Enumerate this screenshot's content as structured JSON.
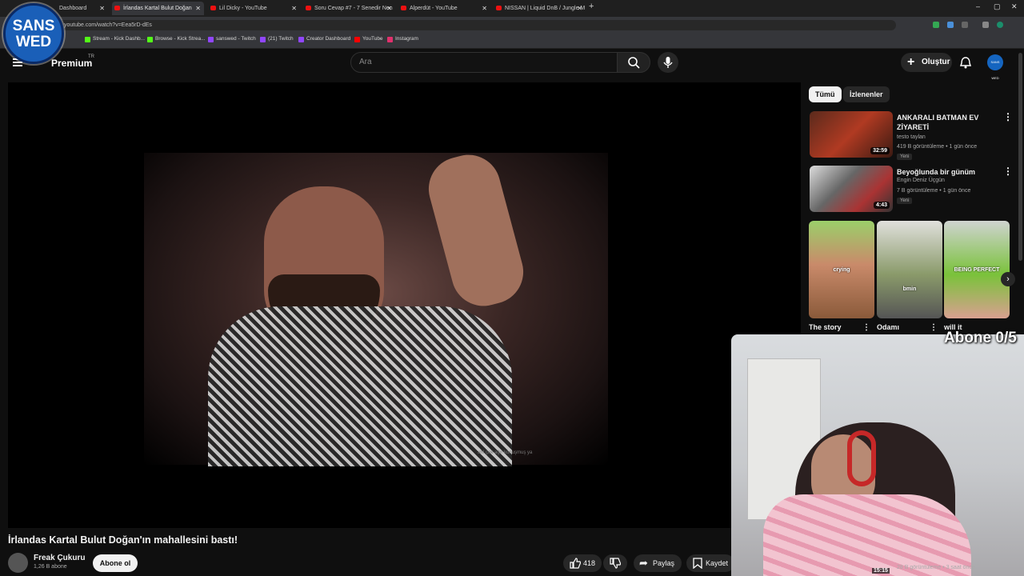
{
  "browser": {
    "tabs": [
      {
        "label": "Dashboard",
        "active": false
      },
      {
        "label": "İrlandas Kartal Bulut Doğan",
        "active": true
      },
      {
        "label": "Lil Dicky - YouTube",
        "active": false
      },
      {
        "label": "Soru Cevap #7 - 7 Senedir Nen",
        "active": false
      },
      {
        "label": "Alperdüt - YouTube",
        "active": false
      },
      {
        "label": "NISSAN | Liquid DnB / Jungle M",
        "active": false
      }
    ],
    "url": "youtube.com/watch?v=Eea5rD-dEs",
    "bookmarks": [
      "Stream - Kick Dashb...",
      "Browse - Kick Strea...",
      "sanswed - Twitch",
      "(21) Twitch",
      "Creator Dashboard",
      "YouTube",
      "Instagram"
    ]
  },
  "overlay": {
    "logo_line1": "SANS",
    "logo_line2": "WED",
    "abone": "Abone 0/5"
  },
  "header": {
    "logo": "Premium",
    "region": "TR",
    "search_placeholder": "Ara",
    "create_label": "Oluştur",
    "avatar_text": "SANS WED"
  },
  "video": {
    "title": "İrlandas Kartal Bulut Doğan'ın mahallesini bastı!",
    "chat_line": "ah! çok ağır konuşmuş ya",
    "channel": "Freak Çukuru",
    "subscribers": "1,26 B abone",
    "subscribe_label": "Abone ol",
    "likes": "418",
    "share_label": "Paylaş",
    "save_label": "Kaydet"
  },
  "sidebar": {
    "chips": [
      "Tümü",
      "İzlenenler"
    ],
    "videos": [
      {
        "title": "ANKARALI BATMAN EV ZİYARETİ",
        "channel": "testo taylan",
        "meta": "419 B görüntüleme • 1 gün önce",
        "badge": "Yeni",
        "duration": "32:59"
      },
      {
        "title": "Beyoğlunda bir günüm",
        "channel": "Engin Deniz Üçgün",
        "meta": "7 B görüntüleme • 1 gün önce",
        "badge": "Yeni",
        "duration": "4:43"
      }
    ],
    "shorts": [
      {
        "title": "The story",
        "overlay": "crying"
      },
      {
        "title": "Odamı",
        "overlay": "bmin"
      },
      {
        "title": "will it",
        "overlay": "BEING PERFECT"
      }
    ],
    "bottom_duration": "15:15",
    "bottom_meta": "28 B görüntüleme • 3 saat önce"
  }
}
